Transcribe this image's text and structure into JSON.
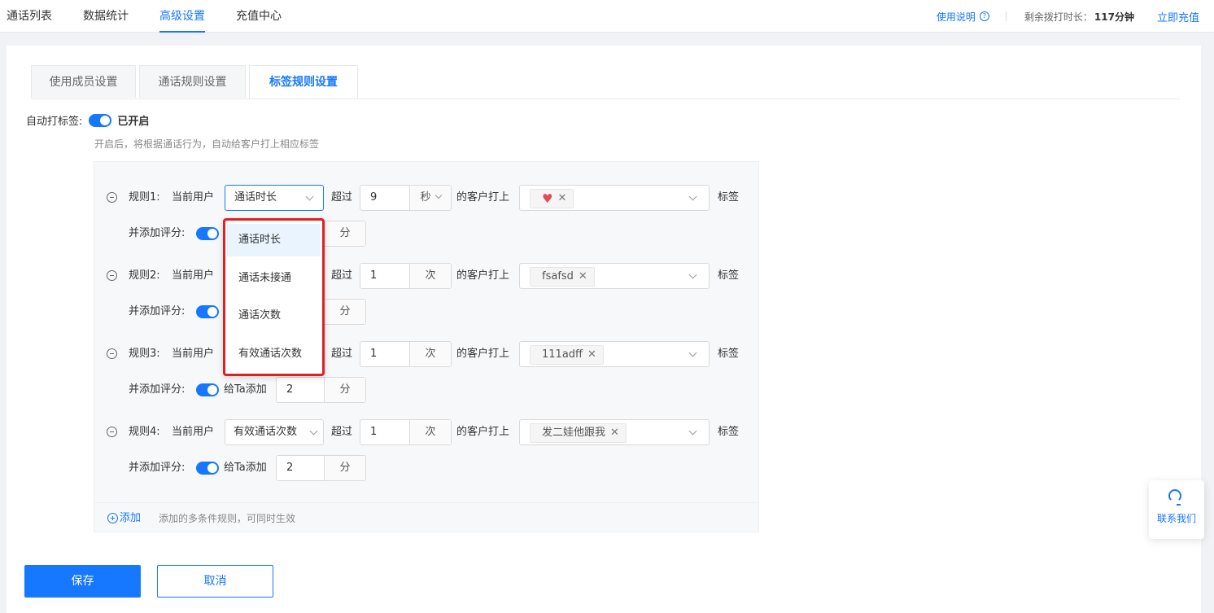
{
  "topnav": {
    "items": [
      "通话列表",
      "数据统计",
      "高级设置",
      "充值中心"
    ],
    "active_index": 2
  },
  "topright": {
    "help": "使用说明",
    "remain_label": "剩余拨打时长：",
    "remain_value": "117分钟",
    "recharge": "立即充值"
  },
  "tabs": [
    "使用成员设置",
    "通话规则设置",
    "标签规则设置"
  ],
  "active_tab": 2,
  "auto_tag": {
    "label": "自动打标签:",
    "status": "已开启",
    "enabled": true,
    "hint": "开启后，将根据通话行为，自动给客户打上相应标签"
  },
  "rule_text": {
    "current_user": "当前用户",
    "exceed": "超过",
    "tag_customer": "的客户打上",
    "tag_suffix": "标签",
    "add_score": "并添加评分:",
    "give_ta": "给Ta添加",
    "score_unit": "分"
  },
  "rules": [
    {
      "label": "规则1:",
      "condition": "通话时长",
      "value": "9",
      "unit": "秒",
      "tag": "",
      "tag_icon": "heart-icon",
      "score": ""
    },
    {
      "label": "规则2:",
      "condition": "",
      "value": "1",
      "unit": "次",
      "tag": "fsafsd",
      "score": ""
    },
    {
      "label": "规则3:",
      "condition": "",
      "value": "1",
      "unit": "次",
      "tag": "111adff",
      "score": "2"
    },
    {
      "label": "规则4:",
      "condition": "有效通话次数",
      "value": "1",
      "unit": "次",
      "tag": "发二娃他跟我",
      "score": "2"
    }
  ],
  "dropdown": {
    "options": [
      "通话时长",
      "通话未接通",
      "通话次数",
      "有效通话次数"
    ],
    "selected_index": 0
  },
  "add_rule": {
    "link": "添加",
    "hint": "添加的多条件规则，可同时生效"
  },
  "buttons": {
    "save": "保存",
    "cancel": "取消"
  },
  "contact": {
    "label": "联系我们"
  },
  "colors": {
    "primary": "#1677ff",
    "highlight_border": "#e02020"
  }
}
